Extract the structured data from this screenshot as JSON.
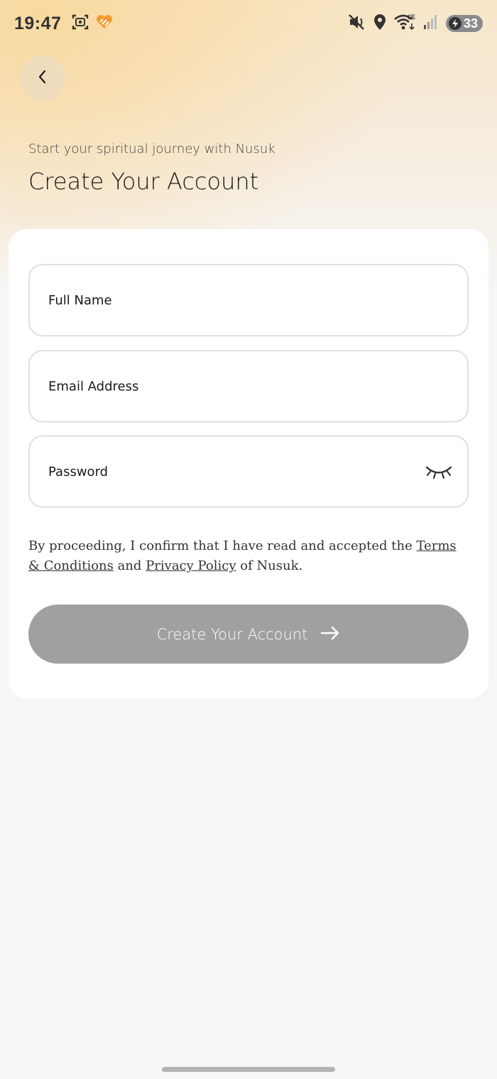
{
  "status_bar": {
    "time": "19:47",
    "battery_level": "33",
    "network_label": "6E"
  },
  "header": {
    "back_icon": "chevron-left-icon",
    "subtitle": "Start your spiritual journey with Nusuk",
    "title": "Create Your Account"
  },
  "form": {
    "full_name": {
      "placeholder": "Full Name",
      "value": ""
    },
    "email": {
      "placeholder": "Email Address",
      "value": ""
    },
    "password": {
      "placeholder": "Password",
      "value": "",
      "toggle_icon": "eye-closed-icon"
    }
  },
  "legal": {
    "prefix": "By proceeding, I confirm that I have read and accepted the ",
    "terms_link": "Terms & Conditions",
    "middle": " and ",
    "privacy_link": "Privacy Policy",
    "suffix": " of Nusuk."
  },
  "cta": {
    "label": "Create Your Account",
    "icon": "arrow-right-icon",
    "disabled": true
  },
  "colors": {
    "accent_gradient": "#f8d9a0",
    "card_bg": "#ffffff",
    "page_bg": "#f6f6f6",
    "cta_disabled_bg": "#a0a0a0",
    "brand_orange": "#f39a2b"
  }
}
